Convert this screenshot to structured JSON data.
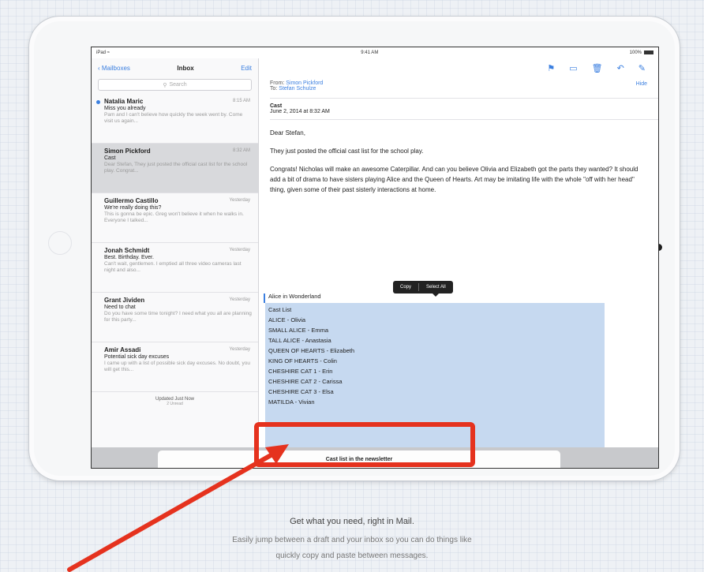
{
  "status": {
    "left": "iPad ≈",
    "time": "9:41 AM",
    "battery": "100%"
  },
  "sidebar": {
    "back_label": "Mailboxes",
    "title": "Inbox",
    "edit_label": "Edit",
    "search_placeholder": "Search",
    "messages": [
      {
        "from": "Natalia Maric",
        "date": "8:15 AM",
        "subject": "Miss you already",
        "preview": "Pam and I can't believe how quickly the week went by. Come visit us again...",
        "unread": true
      },
      {
        "from": "Simon Pickford",
        "date": "8:32 AM",
        "subject": "Cast",
        "preview": "Dear Stefan, They just posted the official cast list for the school play. Congrat...",
        "unread": false
      },
      {
        "from": "Guillermo Castillo",
        "date": "Yesterday",
        "subject": "We're really doing this?",
        "preview": "This is gonna be epic. Greg won't believe it when he walks in. Everyone I talked...",
        "unread": false
      },
      {
        "from": "Jonah Schmidt",
        "date": "Yesterday",
        "subject": "Best. Birthday. Ever.",
        "preview": "Can't wait, gentlemen. I emptied all three video cameras last night and also...",
        "unread": false
      },
      {
        "from": "Grant Jividen",
        "date": "Yesterday",
        "subject": "Need to chat",
        "preview": "Do you have some time tonight? I need what you all are planning for this party...",
        "unread": false
      },
      {
        "from": "Amir Assadi",
        "date": "Yesterday",
        "subject": "Potential sick day excuses",
        "preview": "I came up with a list of possible sick day excuses. No doubt, you will get this...",
        "unread": false
      }
    ],
    "updated": "Updated Just Now",
    "updated_sub": "2 Unread"
  },
  "message": {
    "from_label": "From:",
    "from_name": "Simon Pickford",
    "to_label": "To:",
    "to_name": "Stefan Schulze",
    "hide_label": "Hide",
    "subject": "Cast",
    "date": "June 2, 2014 at 8:32 AM",
    "greeting": "Dear Stefan,",
    "para1": "They just posted the official cast list for the school play.",
    "para2": "Congrats! Nicholas will make an awesome Caterpillar. And can you believe Olivia and Elizabeth got the parts they wanted? It should add a bit of drama to have sisters playing Alice and the Queen of Hearts. Art may be imitating life with the whole \"off with her head\" thing, given some of their past sisterly interactions at home.",
    "heading": "Alice in Wonderland",
    "cast_title": "Cast List",
    "cast": [
      "ALICE - Olivia",
      "SMALL ALICE - Emma",
      "TALL ALICE - Anastasia",
      "QUEEN OF HEARTS - Elizabeth",
      "KING OF HEARTS - Colin",
      "CHESHIRE CAT 1 - Erin",
      "CHESHIRE CAT 2 - Carissa",
      "CHESHIRE CAT 3 - Elsa",
      "MATILDA - Vivian"
    ]
  },
  "popup": {
    "copy": "Copy",
    "select_all": "Select All"
  },
  "draft": {
    "title": "Cast list in the newsletter"
  },
  "captions": {
    "headline": "Get what you need, right in Mail.",
    "line1": "Easily jump between a draft and your inbox so you can do things like",
    "line2": "quickly copy and paste between messages."
  },
  "colors": {
    "annotation": "#e5321e",
    "accent": "#3b7fe0",
    "selection": "#c6d9f0"
  }
}
